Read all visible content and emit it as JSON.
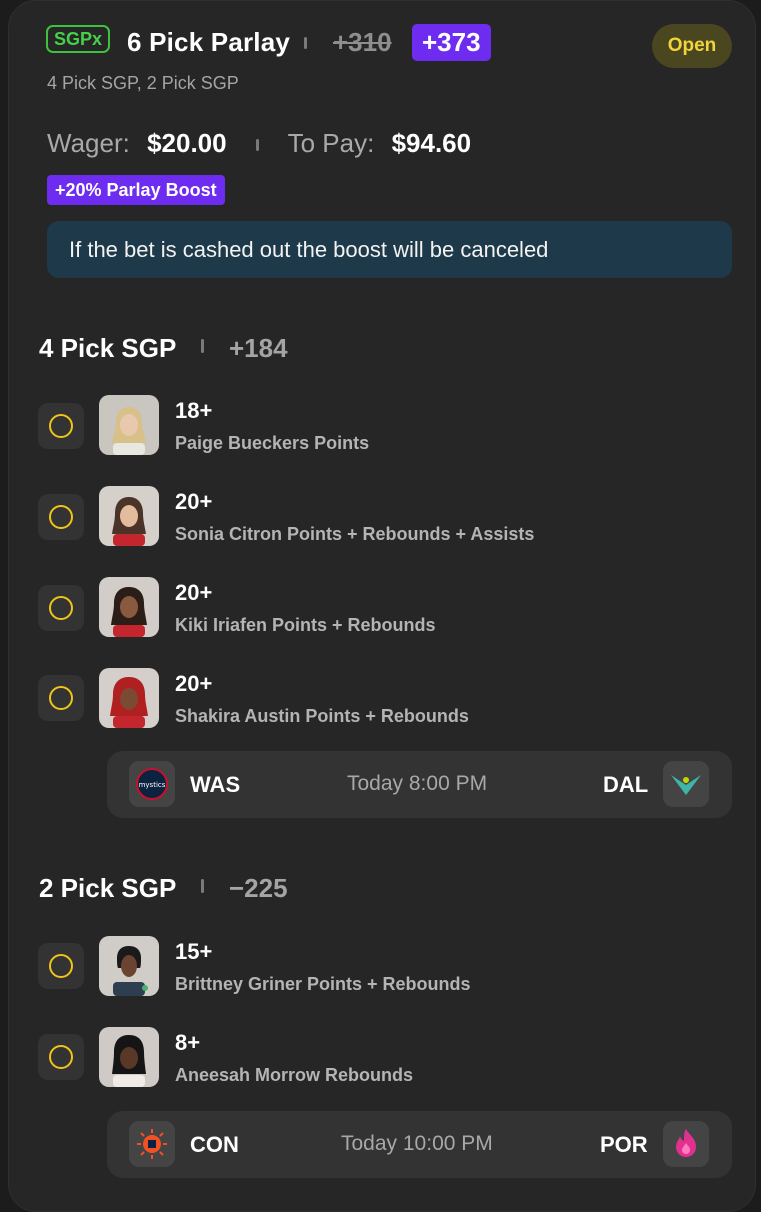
{
  "header": {
    "badge": "SGPx",
    "title": "6 Pick Parlay",
    "old_odds": "+310",
    "new_odds": "+373",
    "status": "Open",
    "subtitle": "4 Pick SGP, 2 Pick SGP"
  },
  "wager": {
    "wager_label": "Wager:",
    "wager_value": "$20.00",
    "to_pay_label": "To Pay:",
    "to_pay_value": "$94.60"
  },
  "boost": {
    "badge": "+20% Parlay Boost",
    "notice": "If the bet is cashed out the boost will be canceled"
  },
  "sections": [
    {
      "title": "4 Pick SGP",
      "odds": "+184",
      "picks": [
        {
          "value": "18+",
          "desc": "Paige Bueckers Points"
        },
        {
          "value": "20+",
          "desc": "Sonia Citron Points + Rebounds + Assists"
        },
        {
          "value": "20+",
          "desc": "Kiki Iriafen Points + Rebounds"
        },
        {
          "value": "20+",
          "desc": "Shakira Austin Points + Rebounds"
        }
      ],
      "game": {
        "away": "WAS",
        "time": "Today 8:00 PM",
        "home": "DAL"
      }
    },
    {
      "title": "2 Pick SGP",
      "odds": "−225",
      "picks": [
        {
          "value": "15+",
          "desc": "Brittney Griner Points + Rebounds"
        },
        {
          "value": "8+",
          "desc": "Aneesah Morrow Rebounds"
        }
      ],
      "game": {
        "away": "CON",
        "time": "Today 10:00 PM",
        "home": "POR"
      }
    }
  ],
  "colors": {
    "accent_purple": "#6d2cf0",
    "sgpx_green": "#46d04a",
    "open_yellow": "#f2d33a",
    "pending_circle": "#f0c419",
    "notice_bg": "#1e3a4a"
  }
}
